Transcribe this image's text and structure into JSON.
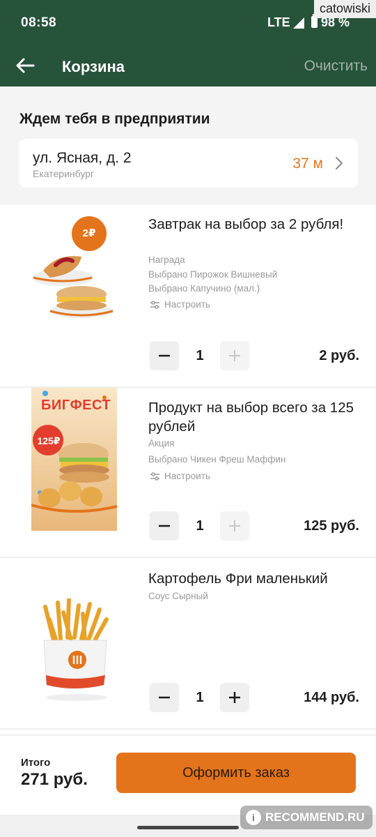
{
  "status_bar": {
    "time": "08:58",
    "network": "LTE",
    "battery": "98 %"
  },
  "watermarks": {
    "top": "catowiski",
    "bottom": "RECOMMEND.RU"
  },
  "header": {
    "title": "Корзина",
    "clear_label": "Очистить"
  },
  "pickup": {
    "heading": "Ждем тебя в предприятии",
    "street": "ул. Ясная, д. 2",
    "city": "Екатеринбург",
    "distance": "37 м"
  },
  "items": [
    {
      "title": "Завтрак на выбор за 2 рубля!",
      "type": "Награда",
      "selections": [
        "Выбрано Пирожок Вишневый",
        "Выбрано Капучино (мал.)"
      ],
      "customize_label": "Настроить",
      "badge": "2₽",
      "quantity": "1",
      "price": "2 руб."
    },
    {
      "title": "Продукт на выбор всего за 125 рублей",
      "type": "Акция",
      "selections": [
        "Выбрано Чикен Фреш Маффин"
      ],
      "customize_label": "Настроить",
      "banner_text": "БИГФЕСТ",
      "badge": "125₽",
      "quantity": "1",
      "price": "125 руб."
    },
    {
      "title": "Картофель Фри маленький",
      "type": "Соус Сырный",
      "quantity": "1",
      "price": "144 руб."
    }
  ],
  "footer": {
    "total_label": "Итого",
    "total_value": "271 руб.",
    "checkout_label": "Оформить заказ"
  },
  "colors": {
    "header_bg": "#27533a",
    "accent": "#e3741b",
    "distance": "#e5761b",
    "muted": "#9a9a9a"
  }
}
